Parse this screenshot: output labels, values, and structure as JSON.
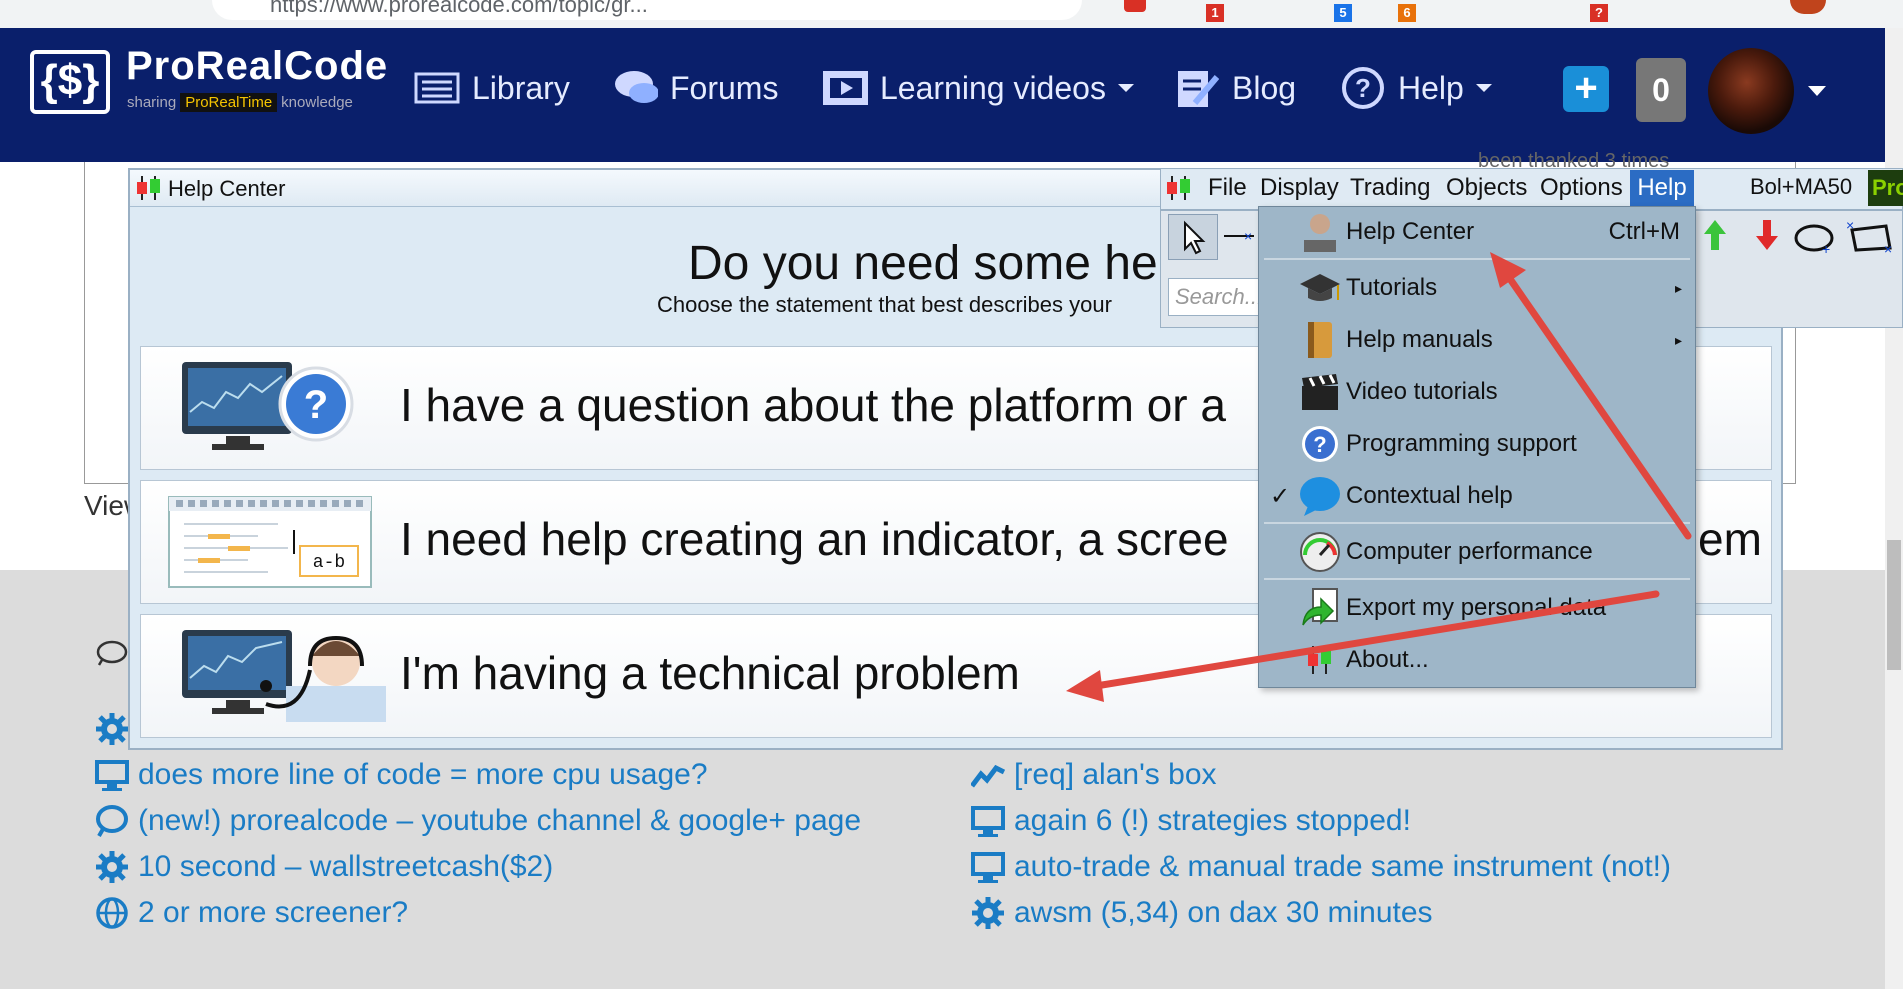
{
  "browser": {
    "url_fragment": "https://www.prorealcode.com/topic/gr...",
    "badges": [
      "1",
      "5",
      "6",
      "?"
    ]
  },
  "site": {
    "logo": {
      "name": "ProRealCode",
      "tagline_pre": "sharing",
      "tagline_highlight": "ProRealTime",
      "tagline_post": "knowledge"
    },
    "nav": {
      "library": "Library",
      "forums": "Forums",
      "learning_videos": "Learning videos",
      "blog": "Blog",
      "help": "Help"
    },
    "plus_label": "+",
    "notification_count": "0"
  },
  "page": {
    "thanked_text": "been thanked 3 times",
    "view_text": "View"
  },
  "topics": {
    "left": [
      {
        "icon": "gear-icon",
        "title": ""
      },
      {
        "icon": "monitor-icon",
        "title": "does more line of code = more cpu usage?"
      },
      {
        "icon": "speech-bubble-icon",
        "title": "(new!) prorealcode – youtube channel & google+ page"
      },
      {
        "icon": "gear-icon",
        "title": "10 second – wallstreetcash($2)"
      },
      {
        "icon": "globe-icon",
        "title": "2 or more screener?"
      }
    ],
    "right": [
      {
        "icon": "trend-icon",
        "title": "[req] alan's box"
      },
      {
        "icon": "monitor-icon",
        "title": "again 6 (!) strategies stopped!"
      },
      {
        "icon": "monitor-icon",
        "title": "auto-trade & manual trade same instrument (not!)"
      },
      {
        "icon": "gear-icon",
        "title": "awsm (5,34) on dax 30 minutes"
      }
    ]
  },
  "help_center": {
    "title": "Help Center",
    "heading": "Do you need some he",
    "subheading": "Choose the statement that best describes your",
    "options": [
      {
        "text": "I have a question about the platform or a"
      },
      {
        "text": "I need help creating an indicator, a scree",
        "tail": "em"
      },
      {
        "text": "I'm having a technical problem"
      }
    ]
  },
  "platform": {
    "menus": [
      "File",
      "Display",
      "Trading",
      "Objects",
      "Options",
      "Help"
    ],
    "chart_name": "Bol+MA50",
    "pro_badge": "Pro",
    "search_placeholder": "Search..."
  },
  "help_menu": {
    "items": [
      {
        "label": "Help Center",
        "shortcut": "Ctrl+M",
        "icon": "support-agent-icon"
      },
      {
        "label": "Tutorials",
        "icon": "graduation-cap-icon",
        "submenu": true
      },
      {
        "label": "Help manuals",
        "icon": "book-icon",
        "submenu": true
      },
      {
        "label": "Video tutorials",
        "icon": "clapperboard-icon"
      },
      {
        "label": "Programming support",
        "icon": "question-circle-icon"
      },
      {
        "label": "Contextual help",
        "icon": "blue-bubble-icon",
        "checked": true
      },
      {
        "label": "Computer performance",
        "icon": "gauge-icon"
      },
      {
        "label": "Export my personal data",
        "icon": "export-icon"
      },
      {
        "label": "About...",
        "icon": "candlestick-icon"
      }
    ]
  },
  "colors": {
    "navbar": "#0a1f6b",
    "link": "#1a7cc5",
    "menu_highlight": "#2b6cc4",
    "arrow": "#e0473f"
  }
}
